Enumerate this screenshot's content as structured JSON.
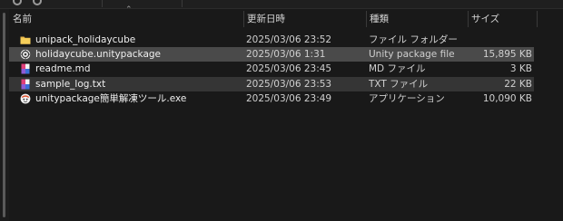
{
  "columns": {
    "name": "名前",
    "date": "更新日時",
    "type": "種類",
    "size": "サイズ"
  },
  "files": [
    {
      "name": "unipack_holidaycube",
      "date": "2025/03/06 23:52",
      "type": "ファイル フォルダー",
      "size": "",
      "icon": "folder-icon"
    },
    {
      "name": "holidaycube.unitypackage",
      "date": "2025/03/06 1:31",
      "type": "Unity package file",
      "size": "15,895 KB",
      "icon": "unity-package-icon"
    },
    {
      "name": "readme.md",
      "date": "2025/03/06 23:45",
      "type": "MD ファイル",
      "size": "3 KB",
      "icon": "markdown-file-icon"
    },
    {
      "name": "sample_log.txt",
      "date": "2025/03/06 23:53",
      "type": "TXT ファイル",
      "size": "22 KB",
      "icon": "text-file-icon"
    },
    {
      "name": "unitypackage簡単解凍ツール.exe",
      "date": "2025/03/06 23:49",
      "type": "アプリケーション",
      "size": "10,090 KB",
      "icon": "exe-app-icon"
    }
  ],
  "colors": {
    "background": "#191919",
    "selected_row": "#4a4a4a",
    "hover_row": "#353535",
    "folder": "#f2c94c"
  }
}
